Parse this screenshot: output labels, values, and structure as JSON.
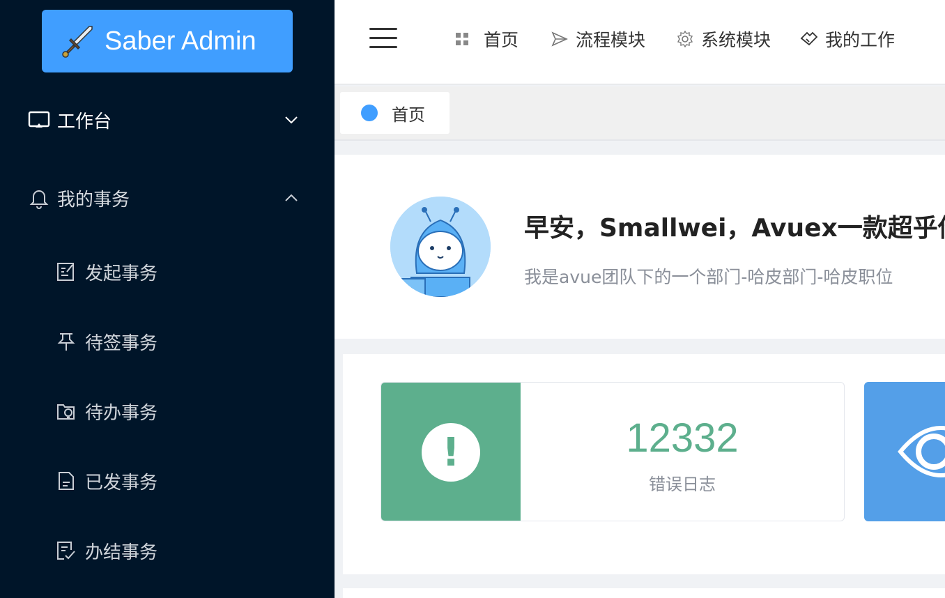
{
  "app": {
    "logo_text": "Saber Admin",
    "accent_color": "#409eff",
    "sidebar_bg": "#001529"
  },
  "sidebar": {
    "groups": [
      {
        "label": "工作台",
        "icon": "monitor-icon",
        "expanded": false
      },
      {
        "label": "我的事务",
        "icon": "bell-icon",
        "expanded": true
      }
    ],
    "items": [
      {
        "label": "发起事务",
        "icon": "edit-document-icon"
      },
      {
        "label": "待签事务",
        "icon": "pin-icon"
      },
      {
        "label": "待办事务",
        "icon": "folder-bulb-icon"
      },
      {
        "label": "已发事务",
        "icon": "document-icon"
      },
      {
        "label": "办结事务",
        "icon": "checked-document-icon"
      }
    ]
  },
  "topnav": {
    "items": [
      {
        "label": "首页",
        "icon": "grid-icon"
      },
      {
        "label": "流程模块",
        "icon": "send-icon"
      },
      {
        "label": "系统模块",
        "icon": "gear-icon"
      },
      {
        "label": "我的工作",
        "icon": "handshake-icon"
      }
    ]
  },
  "tags": [
    {
      "label": "首页",
      "active": true
    }
  ],
  "welcome": {
    "title": "早安，Smallwei，Avuex一款超乎你",
    "subtitle": "我是avue团队下的一个部门-哈皮部门-哈皮职位"
  },
  "stats": [
    {
      "value": "12332",
      "label": "错误日志",
      "icon": "exclamation-icon",
      "color": "#5daf8d"
    },
    {
      "icon": "eye-icon",
      "color": "#549fe8"
    }
  ]
}
